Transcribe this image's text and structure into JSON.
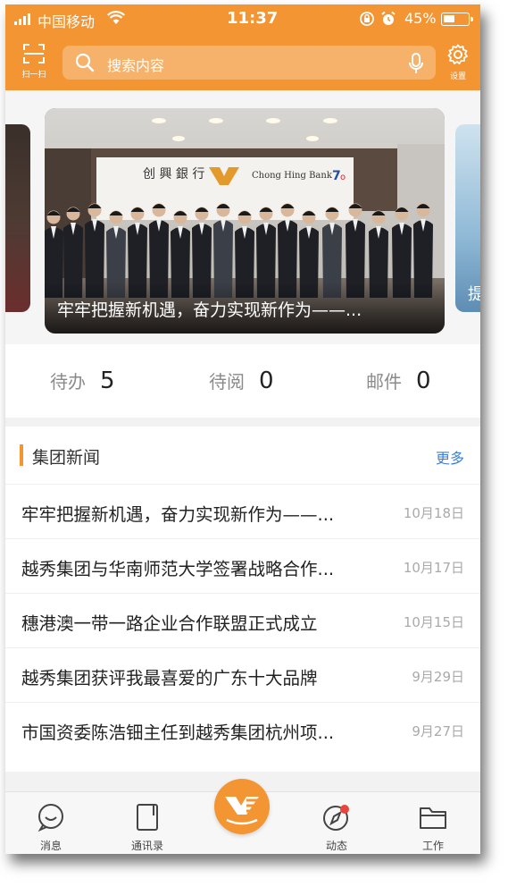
{
  "status_bar": {
    "carrier": "中国移动",
    "time": "11:37",
    "battery_percent": "45%",
    "battery_level": 0.45
  },
  "header": {
    "scan_label": "扫一扫",
    "search_placeholder": "搜索内容",
    "settings_label": "设置",
    "accent_color": "#f39533"
  },
  "banner": {
    "main_caption": "牢牢把握新机遇，奋力实现新作为——...",
    "right_card_text": "提"
  },
  "counters": [
    {
      "label": "待办",
      "value": "5"
    },
    {
      "label": "待阅",
      "value": "0"
    },
    {
      "label": "邮件",
      "value": "0"
    }
  ],
  "news": {
    "title": "集团新闻",
    "more": "更多",
    "items": [
      {
        "title": "牢牢把握新机遇，奋力实现新作为——...",
        "date": "10月18日"
      },
      {
        "title": "越秀集团与华南师范大学签署战略合作...",
        "date": "10月17日"
      },
      {
        "title": "穗港澳一带一路企业合作联盟正式成立",
        "date": "10月15日"
      },
      {
        "title": "越秀集团获评我最喜爱的广东十大品牌",
        "date": "9月29日"
      },
      {
        "title": "市国资委陈浩钿主任到越秀集团杭州项...",
        "date": "9月27日"
      }
    ]
  },
  "tabbar": {
    "tabs": [
      {
        "label": "消息",
        "icon": "chat-bubble-icon"
      },
      {
        "label": "通讯录",
        "icon": "contacts-book-icon"
      },
      {
        "label": "动态",
        "icon": "compass-icon"
      },
      {
        "label": "工作",
        "icon": "folder-icon"
      }
    ],
    "center_icon": "ye-logo-icon"
  }
}
